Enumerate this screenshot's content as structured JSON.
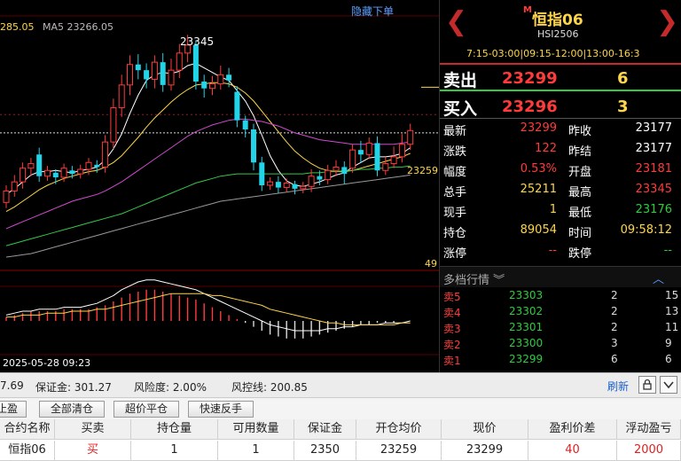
{
  "chart": {
    "hide_order_link": "隐藏下单",
    "ma_legend_value": "285.05",
    "ma5_label": "MA5 23266.05",
    "high_label": "23345",
    "current_price_label": "23259",
    "bottom_value": "49",
    "date_time": "2025-05-28 09:23"
  },
  "chart_data": {
    "type": "candlestick",
    "candles": [
      {
        "o": 23198,
        "c": 23208,
        "h": 23213,
        "l": 23193
      },
      {
        "o": 23208,
        "c": 23216,
        "h": 23222,
        "l": 23203
      },
      {
        "o": 23216,
        "c": 23228,
        "h": 23233,
        "l": 23210
      },
      {
        "o": 23228,
        "c": 23232,
        "h": 23237,
        "l": 23221
      },
      {
        "o": 23240,
        "c": 23221,
        "h": 23246,
        "l": 23216
      },
      {
        "o": 23221,
        "c": 23226,
        "h": 23230,
        "l": 23217
      },
      {
        "o": 23224,
        "c": 23220,
        "h": 23227,
        "l": 23214
      },
      {
        "o": 23220,
        "c": 23228,
        "h": 23232,
        "l": 23216
      },
      {
        "o": 23226,
        "c": 23223,
        "h": 23230,
        "l": 23219
      },
      {
        "o": 23223,
        "c": 23227,
        "h": 23231,
        "l": 23219
      },
      {
        "o": 23227,
        "c": 23233,
        "h": 23237,
        "l": 23222
      },
      {
        "o": 23231,
        "c": 23229,
        "h": 23235,
        "l": 23224
      },
      {
        "o": 23229,
        "c": 23251,
        "h": 23257,
        "l": 23224
      },
      {
        "o": 23251,
        "c": 23281,
        "h": 23289,
        "l": 23245
      },
      {
        "o": 23281,
        "c": 23301,
        "h": 23310,
        "l": 23273
      },
      {
        "o": 23301,
        "c": 23319,
        "h": 23327,
        "l": 23292
      },
      {
        "o": 23319,
        "c": 23314,
        "h": 23328,
        "l": 23306
      },
      {
        "o": 23314,
        "c": 23306,
        "h": 23320,
        "l": 23298
      },
      {
        "o": 23306,
        "c": 23321,
        "h": 23327,
        "l": 23298
      },
      {
        "o": 23321,
        "c": 23301,
        "h": 23329,
        "l": 23295
      },
      {
        "o": 23301,
        "c": 23314,
        "h": 23324,
        "l": 23296
      },
      {
        "o": 23314,
        "c": 23329,
        "h": 23337,
        "l": 23307
      },
      {
        "o": 23329,
        "c": 23336,
        "h": 23345,
        "l": 23321
      },
      {
        "o": 23336,
        "c": 23304,
        "h": 23340,
        "l": 23297
      },
      {
        "o": 23304,
        "c": 23298,
        "h": 23310,
        "l": 23290
      },
      {
        "o": 23298,
        "c": 23302,
        "h": 23309,
        "l": 23292
      },
      {
        "o": 23302,
        "c": 23310,
        "h": 23318,
        "l": 23297
      },
      {
        "o": 23310,
        "c": 23305,
        "h": 23316,
        "l": 23299
      },
      {
        "o": 23295,
        "c": 23270,
        "h": 23300,
        "l": 23264
      },
      {
        "o": 23270,
        "c": 23262,
        "h": 23274,
        "l": 23255
      },
      {
        "o": 23262,
        "c": 23233,
        "h": 23267,
        "l": 23226
      },
      {
        "o": 23233,
        "c": 23213,
        "h": 23238,
        "l": 23208
      },
      {
        "o": 23213,
        "c": 23216,
        "h": 23220,
        "l": 23209
      },
      {
        "o": 23216,
        "c": 23211,
        "h": 23221,
        "l": 23206
      },
      {
        "o": 23211,
        "c": 23215,
        "h": 23219,
        "l": 23207
      },
      {
        "o": 23214,
        "c": 23210,
        "h": 23217,
        "l": 23205
      },
      {
        "o": 23210,
        "c": 23212,
        "h": 23216,
        "l": 23206
      },
      {
        "o": 23212,
        "c": 23221,
        "h": 23227,
        "l": 23207
      },
      {
        "o": 23221,
        "c": 23218,
        "h": 23226,
        "l": 23213
      },
      {
        "o": 23218,
        "c": 23226,
        "h": 23231,
        "l": 23214
      },
      {
        "o": 23226,
        "c": 23229,
        "h": 23235,
        "l": 23221
      },
      {
        "o": 23229,
        "c": 23223,
        "h": 23234,
        "l": 23214
      },
      {
        "o": 23228,
        "c": 23244,
        "h": 23249,
        "l": 23224
      },
      {
        "o": 23244,
        "c": 23240,
        "h": 23252,
        "l": 23233
      },
      {
        "o": 23240,
        "c": 23250,
        "h": 23255,
        "l": 23236
      },
      {
        "o": 23250,
        "c": 23226,
        "h": 23256,
        "l": 23221
      },
      {
        "o": 23226,
        "c": 23232,
        "h": 23238,
        "l": 23222
      },
      {
        "o": 23232,
        "c": 23238,
        "h": 23247,
        "l": 23228
      },
      {
        "o": 23238,
        "c": 23249,
        "h": 23258,
        "l": 23233
      },
      {
        "o": 23249,
        "c": 23261,
        "h": 23267,
        "l": 23244
      }
    ],
    "ma_lines": [
      {
        "color": "#ffffff",
        "values": [
          23205,
          23210,
          23216,
          23222,
          23225,
          23225,
          23226,
          23225,
          23224,
          23226,
          23227,
          23229,
          23235,
          23245,
          23258,
          23276,
          23292,
          23305,
          23310,
          23312,
          23311,
          23313,
          23318,
          23320,
          23316,
          23312,
          23308,
          23305,
          23296,
          23287,
          23274,
          23257,
          23239,
          23226,
          23217,
          23213,
          23212,
          23214,
          23216,
          23219,
          23222,
          23224,
          23229,
          23233,
          23237,
          23238,
          23238,
          23239,
          23241,
          23246
        ]
      },
      {
        "color": "#ffd54a",
        "values": [
          23190,
          23194,
          23199,
          23204,
          23209,
          23213,
          23216,
          23219,
          23221,
          23223,
          23225,
          23226,
          23229,
          23233,
          23239,
          23247,
          23255,
          23264,
          23272,
          23279,
          23286,
          23292,
          23297,
          23301,
          23302,
          23303,
          23303,
          23302,
          23299,
          23294,
          23287,
          23278,
          23269,
          23260,
          23251,
          23243,
          23237,
          23232,
          23228,
          23226,
          23225,
          23225,
          23226,
          23228,
          23230,
          23232,
          23234,
          23236,
          23238,
          23241
        ]
      },
      {
        "color": "#d04ad0",
        "values": [
          23175,
          23178,
          23181,
          23184,
          23187,
          23190,
          23193,
          23196,
          23199,
          23201,
          23203,
          23205,
          23208,
          23212,
          23216,
          23221,
          23226,
          23231,
          23236,
          23241,
          23246,
          23251,
          23256,
          23260,
          23263,
          23266,
          23268,
          23270,
          23271,
          23271,
          23270,
          23269,
          23267,
          23265,
          23262,
          23259,
          23257,
          23255,
          23253,
          23252,
          23251,
          23250,
          23249,
          23249,
          23249,
          23249,
          23249,
          23249,
          23250,
          23251
        ]
      },
      {
        "color": "#34c84a",
        "values": [
          23160,
          23162,
          23164,
          23166,
          23168,
          23170,
          23172,
          23174,
          23176,
          23178,
          23180,
          23182,
          23184,
          23186,
          23188,
          23191,
          23194,
          23197,
          23200,
          23203,
          23206,
          23209,
          23212,
          23215,
          23217,
          23219,
          23221,
          23222,
          23223,
          23223,
          23223,
          23223,
          23223,
          23223,
          23223,
          23223,
          23223,
          23224,
          23224,
          23225,
          23225,
          23226,
          23226,
          23227,
          23227,
          23228,
          23228,
          23229,
          23229,
          23230
        ]
      },
      {
        "color": "#999999",
        "values": [
          23150,
          23151,
          23152,
          23153,
          23155,
          23157,
          23159,
          23161,
          23163,
          23165,
          23167,
          23169,
          23171,
          23173,
          23175,
          23177,
          23179,
          23181,
          23183,
          23185,
          23187,
          23189,
          23191,
          23193,
          23195,
          23197,
          23199,
          23200,
          23201,
          23202,
          23203,
          23204,
          23205,
          23206,
          23207,
          23208,
          23209,
          23210,
          23211,
          23212,
          23213,
          23214,
          23215,
          23216,
          23217,
          23218,
          23219,
          23220,
          23221,
          23222
        ]
      }
    ],
    "macd": [
      2,
      3,
      4,
      5,
      5,
      5,
      5,
      6,
      6,
      6,
      6,
      7,
      8,
      10,
      12,
      14,
      15,
      16,
      16,
      15,
      14,
      13,
      12,
      11,
      9,
      7,
      5,
      3,
      1,
      -1,
      -3,
      -5,
      -7,
      -8,
      -9,
      -9,
      -9,
      -8,
      -7,
      -6,
      -5,
      -4,
      -3,
      -2,
      -2,
      -1,
      -1,
      -1,
      0,
      0
    ],
    "dif": [
      3,
      4,
      5,
      5,
      6,
      6,
      6,
      7,
      7,
      7,
      8,
      9,
      11,
      13,
      16,
      18,
      20,
      21,
      21,
      20,
      19,
      18,
      17,
      16,
      14,
      12,
      10,
      8,
      6,
      4,
      2,
      0,
      -2,
      -3,
      -4,
      -5,
      -5,
      -5,
      -5,
      -4,
      -4,
      -3,
      -3,
      -2,
      -2,
      -2,
      -1,
      -1,
      -1,
      0
    ],
    "dea": [
      2,
      2,
      3,
      3,
      3,
      4,
      4,
      4,
      5,
      5,
      5,
      6,
      6,
      7,
      8,
      9,
      10,
      11,
      12,
      13,
      14,
      14,
      14,
      14,
      14,
      13,
      13,
      12,
      11,
      10,
      9,
      8,
      6,
      5,
      4,
      3,
      2,
      1,
      0,
      -1,
      -1,
      -2,
      -2,
      -2,
      -2,
      -2,
      -2,
      -2,
      -1,
      -1
    ],
    "ylim": [
      23150,
      23360
    ],
    "high": 23345,
    "reference_price": 23259
  },
  "quote": {
    "badge": "M",
    "title": "恒指06",
    "code": "HSI2506",
    "sessions": "7:15-03:00|09:15-12:00|13:00-16:3",
    "sell_label": "卖出",
    "sell_price": "23299",
    "sell_volume": "6",
    "buy_label": "买入",
    "buy_price": "23296",
    "buy_volume": "3",
    "stats": [
      {
        "k1": "最新",
        "v1": "23299",
        "k2": "昨收",
        "v2": "23177"
      },
      {
        "k1": "涨跌",
        "v1": "122",
        "k2": "昨结",
        "v2": "23177"
      },
      {
        "k1": "幅度",
        "v1": "0.53%",
        "k2": "开盘",
        "v2": "23181"
      },
      {
        "k1": "总手",
        "v1": "25211",
        "k2": "最高",
        "v2": "23345"
      },
      {
        "k1": "现手",
        "v1": "1",
        "k2": "最低",
        "v2": "23176"
      },
      {
        "k1": "持仓",
        "v1": "89054",
        "k2": "时间",
        "v2": "09:58:12"
      },
      {
        "k1": "涨停",
        "v1": "--",
        "k2": "跌停",
        "v2": "--"
      }
    ],
    "depth_title": "多档行情 ︾",
    "depth_collapse": "︿",
    "depth": [
      {
        "label": "卖5",
        "price": "23303",
        "qty": "2",
        "qty2": "15"
      },
      {
        "label": "卖4",
        "price": "23302",
        "qty": "2",
        "qty2": "13"
      },
      {
        "label": "卖3",
        "price": "23301",
        "qty": "2",
        "qty2": "11"
      },
      {
        "label": "卖2",
        "price": "23300",
        "qty": "3",
        "qty2": "9"
      },
      {
        "label": "卖1",
        "price": "23299",
        "qty": "6",
        "qty2": "6"
      }
    ]
  },
  "account": {
    "partial": "7.69",
    "margin": "保证金: 301.27",
    "risk": "风险度: 2.00%",
    "control": "风控线: 200.85",
    "refresh": "刷新",
    "lock_icon": "lock-icon",
    "dropdown_icon": "chevron-down-icon"
  },
  "actions": {
    "partial": "止盈",
    "close_all": "全部清仓",
    "super_close": "超价平仓",
    "reverse": "快速反手"
  },
  "positions": {
    "headers": [
      "合约名称",
      "买卖",
      "持仓量",
      "可用数量",
      "保证金",
      "开仓均价",
      "现价",
      "盈利价差",
      "浮动盈亏"
    ],
    "rows": [
      [
        "恒指06",
        "买",
        "1",
        "1",
        "2350",
        "23259",
        "23299",
        "40",
        "2000"
      ]
    ]
  },
  "colors": {
    "up": "#ff3b3b",
    "down": "#21d4e8",
    "accent": "#ffd54a",
    "link": "#5aa0ff"
  }
}
